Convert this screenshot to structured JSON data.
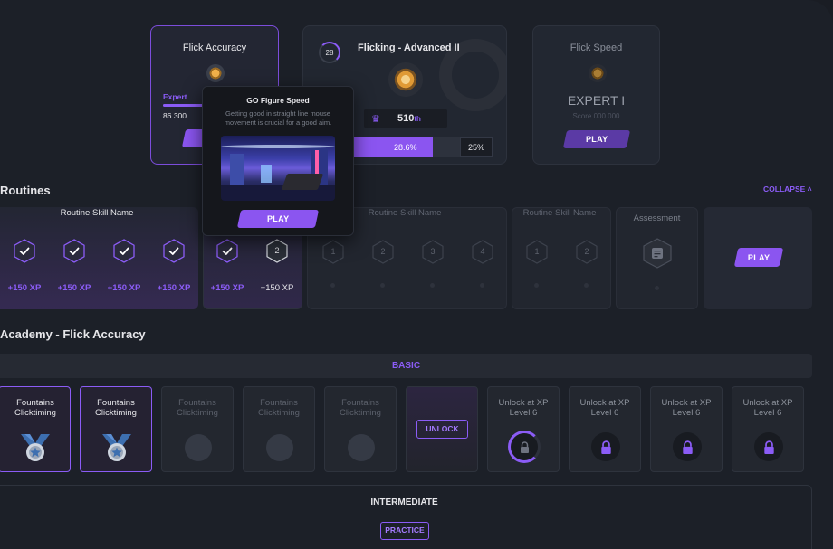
{
  "top_cards": {
    "flick_accuracy": {
      "title": "Flick Accuracy",
      "rank": "Expert",
      "score": "86 300"
    },
    "flicking_advanced": {
      "title": "Flicking - Advanced II",
      "level": "28",
      "position": "510",
      "position_suffix": "th",
      "progress": "28.6%",
      "progress_fraction": 0.286,
      "next": "25%"
    },
    "flick_speed": {
      "title": "Flick Speed",
      "rank": "EXPERT I",
      "score": "Score 000 000",
      "play": "PLAY"
    }
  },
  "tooltip": {
    "title": "GO Figure Speed",
    "description": "Getting good in straight line mouse movement is crucial for a good aim.",
    "play": "PLAY"
  },
  "routines": {
    "title": "Routines",
    "collapse": "COLLAPSE",
    "groups": [
      {
        "name": "Routine Skill Name"
      },
      {
        "name": "Routine Skill Name"
      },
      {
        "name": "Routine Skill Name"
      }
    ],
    "assessment": "Assessment",
    "play": "PLAY",
    "done_xp": [
      "+150 XP",
      "+150 XP",
      "+150 XP",
      "+150 XP",
      "+150 XP"
    ],
    "current_xp": "+150 XP",
    "hex_numbers": {
      "current": "2",
      "g2": [
        "1",
        "2",
        "3",
        "4"
      ],
      "g3": [
        "1",
        "2"
      ]
    }
  },
  "academy": {
    "title": "Academy - Flick Accuracy",
    "basic": "BASIC",
    "tiles": [
      {
        "label": "Fountains Clicktiming"
      },
      {
        "label": "Fountains Clicktiming"
      },
      {
        "label": "Fountains Clicktiming"
      },
      {
        "label": "Fountains Clicktiming"
      },
      {
        "label": "Fountains Clicktiming"
      },
      {
        "label": "UNLOCK"
      },
      {
        "label": "Unlock at XP Level 6"
      },
      {
        "label": "Unlock at XP Level 6"
      },
      {
        "label": "Unlock at XP Level 6"
      },
      {
        "label": "Unlock at XP Level 6"
      }
    ],
    "intermediate": "INTERMEDIATE",
    "practice": "PRACTICE"
  },
  "colors": {
    "accent": "#8b5cf6",
    "bg": "#1c2028",
    "card": "#222731"
  }
}
